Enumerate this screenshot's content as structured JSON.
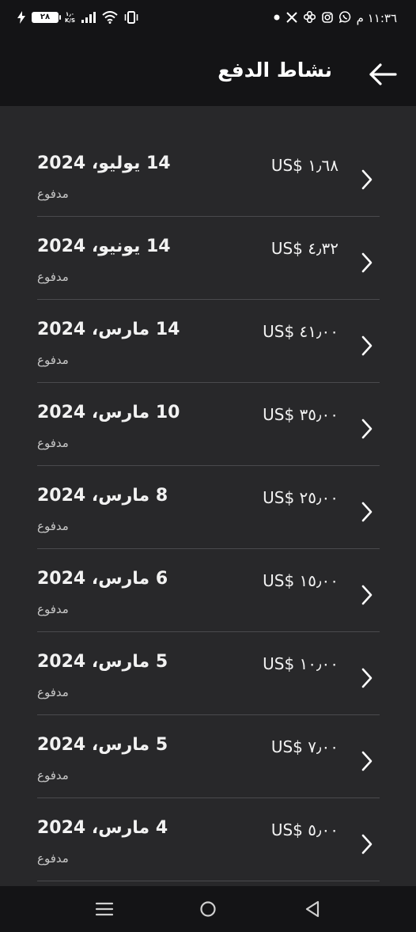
{
  "status_bar": {
    "time": "١١:٣٦ م",
    "battery": "٢٨",
    "speed_value": "١٫٠",
    "speed_unit": "K/S",
    "notification_icons": [
      "dot-icon",
      "x-icon",
      "flower-icon",
      "instagram-icon",
      "whatsapp-icon"
    ],
    "system_icons": [
      "vibrate-icon",
      "wifi-icon",
      "signal-icon",
      "charging-icon"
    ]
  },
  "header": {
    "title": "نشاط الدفع",
    "back_icon": "arrow-right-icon"
  },
  "payments": [
    {
      "date": "14 يوليو، 2024",
      "status": "مدفوع",
      "amount": "US$ ١٫٦٨"
    },
    {
      "date": "14 يونيو، 2024",
      "status": "مدفوع",
      "amount": "US$ ٤٫٣٢"
    },
    {
      "date": "14 مارس، 2024",
      "status": "مدفوع",
      "amount": "US$ ٤١٫٠٠"
    },
    {
      "date": "10 مارس، 2024",
      "status": "مدفوع",
      "amount": "US$ ٣٥٫٠٠"
    },
    {
      "date": "8 مارس، 2024",
      "status": "مدفوع",
      "amount": "US$ ٢٥٫٠٠"
    },
    {
      "date": "6 مارس، 2024",
      "status": "مدفوع",
      "amount": "US$ ١٥٫٠٠"
    },
    {
      "date": "5 مارس، 2024",
      "status": "مدفوع",
      "amount": "US$ ١٠٫٠٠"
    },
    {
      "date": "5 مارس، 2024",
      "status": "مدفوع",
      "amount": "US$ ٧٫٠٠"
    },
    {
      "date": "4 مارس، 2024",
      "status": "مدفوع",
      "amount": "US$ ٥٫٠٠"
    }
  ],
  "nav_bar": {
    "icons": [
      "menu-icon",
      "home-icon",
      "back-triangle-icon"
    ]
  },
  "colors": {
    "background": "#28282a",
    "bar_background": "#141416",
    "divider": "#4a4a4d",
    "text": "#ffffff",
    "muted_text": "#c8c8c8"
  }
}
